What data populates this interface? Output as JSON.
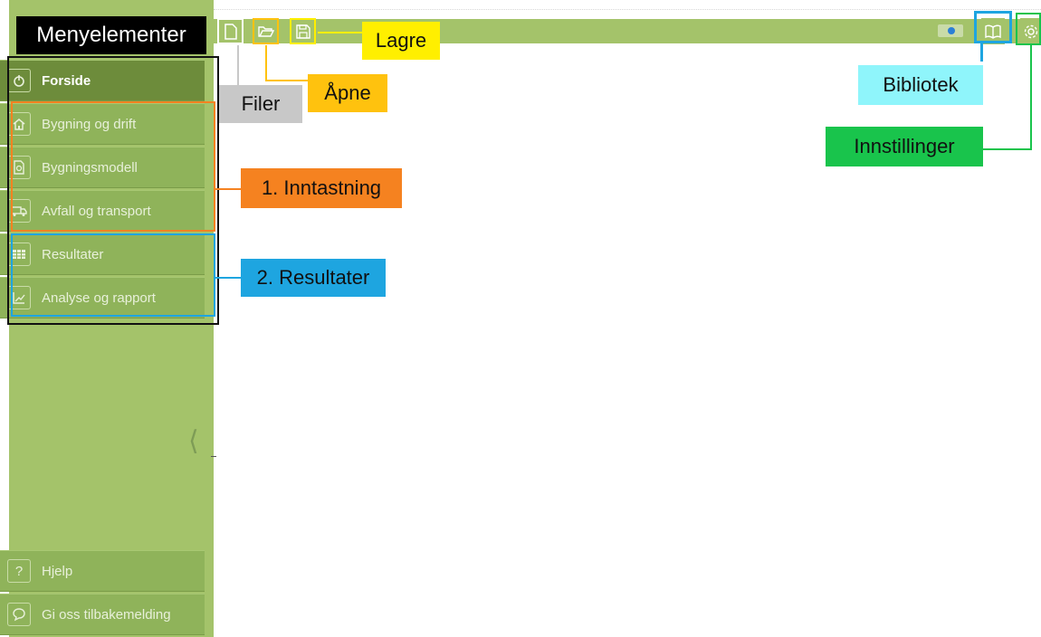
{
  "sidebar": {
    "items": [
      {
        "label": "Forside",
        "icon": "home-circle-icon"
      },
      {
        "label": "Bygning og drift",
        "icon": "house-icon"
      },
      {
        "label": "Bygningsmodell",
        "icon": "document-icon"
      },
      {
        "label": "Avfall og transport",
        "icon": "truck-icon"
      },
      {
        "label": "Resultater",
        "icon": "table-icon"
      },
      {
        "label": "Analyse og rapport",
        "icon": "chart-icon"
      }
    ],
    "footer": [
      {
        "label": "Hjelp",
        "icon": "question-icon"
      },
      {
        "label": "Gi oss tilbakemelding",
        "icon": "chat-bubble-icon"
      }
    ]
  },
  "annotations": {
    "menu": "Menyelementer",
    "lagre": "Lagre",
    "filer": "Filer",
    "apne": "Åpne",
    "bibliotek": "Bibliotek",
    "innstillinger": "Innstillinger",
    "inntastning": "1. Inntastning",
    "resultater": "2. Resultater"
  },
  "colors": {
    "sidebar": "#a4c36a",
    "nav_item": "#8fb35a",
    "nav_active": "#6d8c3b",
    "orange": "#f58220",
    "blue": "#1ea5e0",
    "yellow": "#ffef00",
    "gold": "#ffc20e",
    "gray": "#c8c8c8",
    "cyan": "#8ff5fb",
    "green": "#19c44c"
  }
}
